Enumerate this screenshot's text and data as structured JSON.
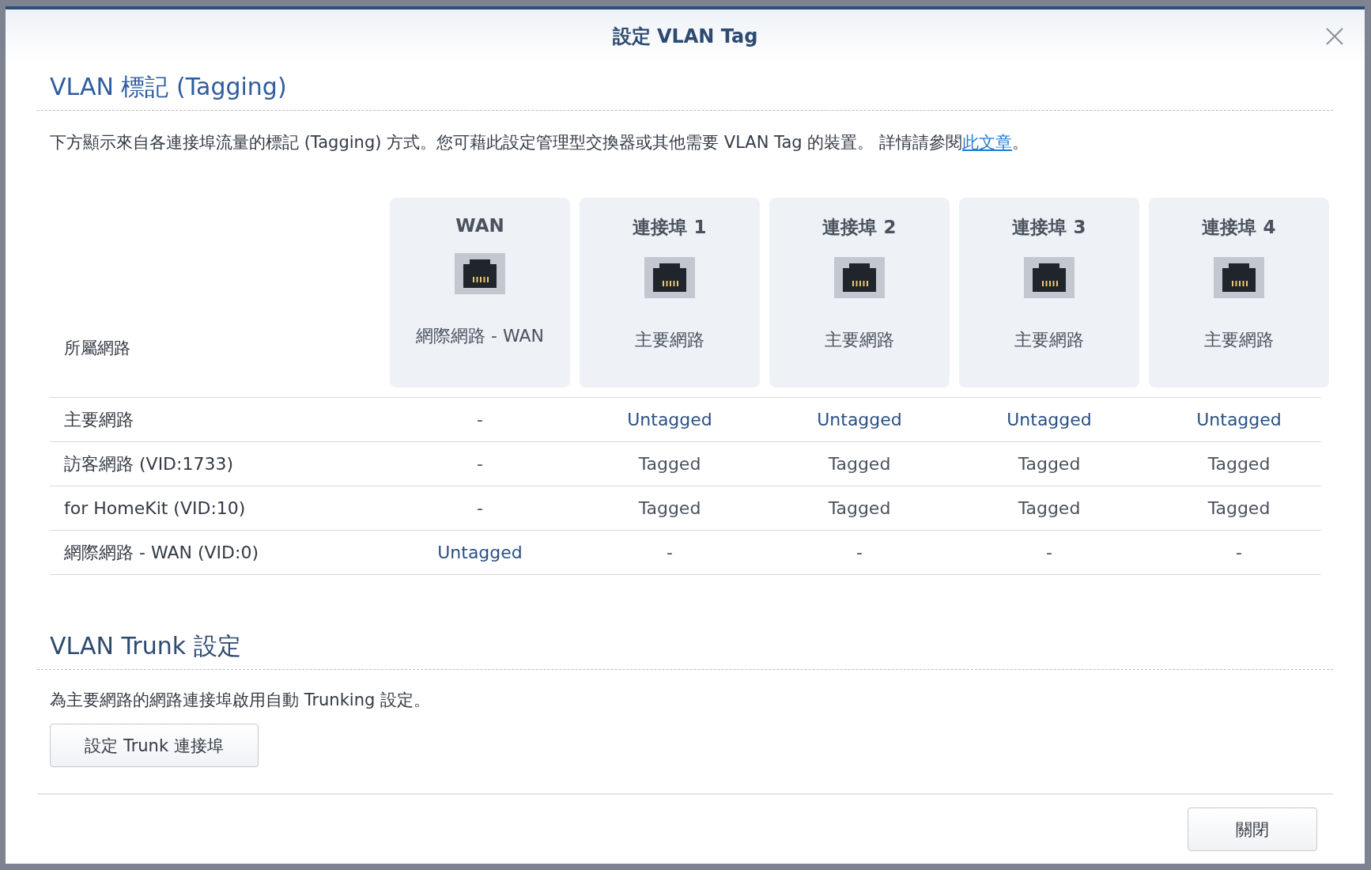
{
  "dialog": {
    "title": "設定 VLAN Tag"
  },
  "tagging_section": {
    "heading": "VLAN 標記 (Tagging)",
    "description": "下方顯示來自各連接埠流量的標記 (Tagging) 方式。您可藉此設定管理型交換器或其他需要 VLAN Tag 的裝置。 詳情請參閱",
    "link": "此文章",
    "description_end": "。"
  },
  "table": {
    "corner_label": "所屬網路",
    "ports": [
      {
        "name": "WAN",
        "network": "網際網路 - WAN"
      },
      {
        "name": "連接埠 1",
        "network": "主要網路"
      },
      {
        "name": "連接埠 2",
        "network": "主要網路"
      },
      {
        "name": "連接埠 3",
        "network": "主要網路"
      },
      {
        "name": "連接埠 4",
        "network": "主要網路"
      }
    ],
    "rows": [
      {
        "network": "主要網路",
        "cells": [
          {
            "text": "-",
            "kind": "none"
          },
          {
            "text": "Untagged",
            "kind": "untagged"
          },
          {
            "text": "Untagged",
            "kind": "untagged"
          },
          {
            "text": "Untagged",
            "kind": "untagged"
          },
          {
            "text": "Untagged",
            "kind": "untagged"
          }
        ]
      },
      {
        "network": "訪客網路 (VID:1733)",
        "cells": [
          {
            "text": "-",
            "kind": "none"
          },
          {
            "text": "Tagged",
            "kind": "tagged"
          },
          {
            "text": "Tagged",
            "kind": "tagged"
          },
          {
            "text": "Tagged",
            "kind": "tagged"
          },
          {
            "text": "Tagged",
            "kind": "tagged"
          }
        ]
      },
      {
        "network": "for HomeKit (VID:10)",
        "cells": [
          {
            "text": "-",
            "kind": "none"
          },
          {
            "text": "Tagged",
            "kind": "tagged"
          },
          {
            "text": "Tagged",
            "kind": "tagged"
          },
          {
            "text": "Tagged",
            "kind": "tagged"
          },
          {
            "text": "Tagged",
            "kind": "tagged"
          }
        ]
      },
      {
        "network": "網際網路 - WAN (VID:0)",
        "cells": [
          {
            "text": "Untagged",
            "kind": "untagged"
          },
          {
            "text": "-",
            "kind": "none"
          },
          {
            "text": "-",
            "kind": "none"
          },
          {
            "text": "-",
            "kind": "none"
          },
          {
            "text": "-",
            "kind": "none"
          }
        ]
      }
    ]
  },
  "trunk_section": {
    "heading": "VLAN Trunk 設定",
    "description": "為主要網路的網路連接埠啟用自動 Trunking 設定。",
    "button": "設定 Trunk 連接埠"
  },
  "buttons": [
    "關閉"
  ]
}
